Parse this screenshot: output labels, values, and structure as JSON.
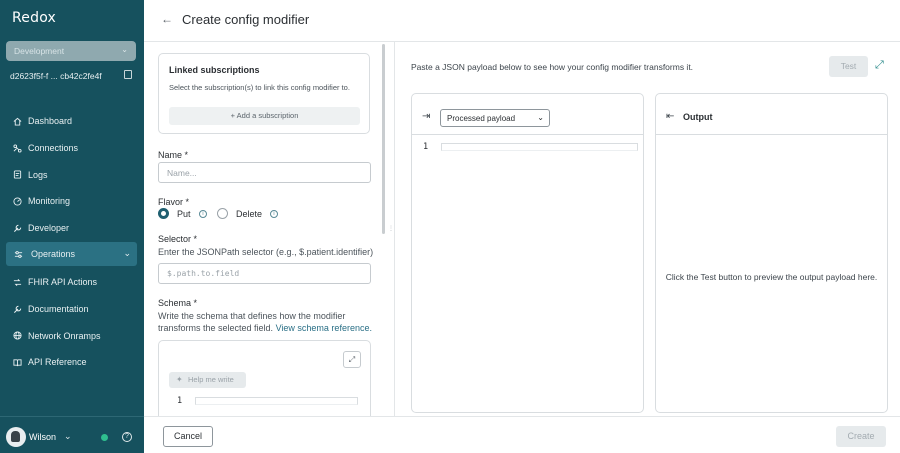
{
  "sidebar": {
    "brand": "Redox",
    "environment": "Development",
    "org_id": "d2623f5f-f ... cb42c2fe4f",
    "items": [
      {
        "label": "Dashboard",
        "icon": "home-icon"
      },
      {
        "label": "Connections",
        "icon": "connections-icon"
      },
      {
        "label": "Logs",
        "icon": "logs-icon"
      },
      {
        "label": "Monitoring",
        "icon": "monitoring-icon"
      },
      {
        "label": "Developer",
        "icon": "wrench-icon"
      },
      {
        "label": "Operations",
        "icon": "operations-icon",
        "active": true
      }
    ],
    "items2": [
      {
        "label": "FHIR API Actions",
        "icon": "api-icon"
      },
      {
        "label": "Documentation",
        "icon": "wrench-icon"
      },
      {
        "label": "Network Onramps",
        "icon": "globe-icon"
      },
      {
        "label": "API Reference",
        "icon": "book-icon"
      }
    ],
    "user": {
      "name": "Wilson"
    },
    "accent": "#16515e"
  },
  "header": {
    "title": "Create config modifier"
  },
  "form": {
    "linked": {
      "title": "Linked subscriptions",
      "subtitle": "Select the subscription(s) to link this config modifier to.",
      "add_label": "+ Add a subscription"
    },
    "name": {
      "label": "Name *",
      "placeholder": "Name..."
    },
    "flavor": {
      "label": "Flavor *",
      "options": [
        "Put",
        "Delete"
      ],
      "selected": "Put"
    },
    "selector": {
      "label": "Selector *",
      "description": "Enter the JSONPath selector (e.g., $.patient.identifier)",
      "placeholder": "$.path.to.field"
    },
    "schema": {
      "label": "Schema *",
      "description_1": "Write the schema that defines how the modifier",
      "description_2": "transforms the selected field.",
      "link": "View schema reference.",
      "help_button": "Help me write",
      "line_number": "1"
    }
  },
  "preview": {
    "hint": "Paste a JSON payload below to see how your config modifier transforms it.",
    "test_label": "Test",
    "input": {
      "select_value": "Processed payload",
      "line_number": "1"
    },
    "output": {
      "title": "Output",
      "message": "Click the Test button to preview the output payload here."
    }
  },
  "footer": {
    "cancel": "Cancel",
    "create": "Create"
  }
}
